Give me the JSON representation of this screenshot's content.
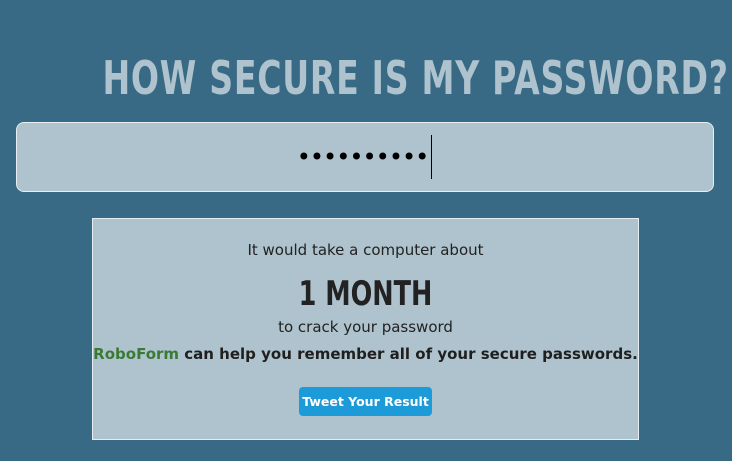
{
  "header": {
    "title": "HOW SECURE IS MY PASSWORD?"
  },
  "password_field": {
    "masked_value": "••••••••••"
  },
  "result": {
    "lead_text": "It would take a computer about",
    "duration": "1 MONTH",
    "trail_text": "to crack your password",
    "promo": {
      "brand_link": "RoboForm",
      "text": " can help you remember all of your secure passwords."
    },
    "tweet_button": "Tweet Your Result"
  },
  "colors": {
    "background": "#386a86",
    "panel": "#aec3cd",
    "title": "#aec3cd",
    "brand_link": "#3a7a35",
    "tweet_button": "#1d9bd8"
  }
}
